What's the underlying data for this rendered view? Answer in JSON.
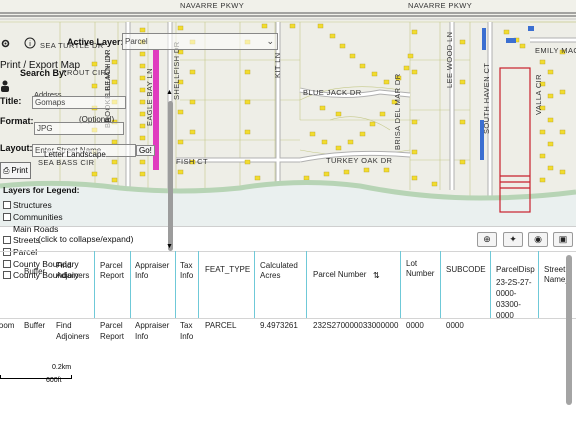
{
  "map": {
    "streets": {
      "navarre": "NAVARRE PKWY",
      "navarre2": "NAVARRE PKWY",
      "laurel_dr": "LAUREL DR",
      "emily": "EMILY MAG",
      "trout": "TROUT CIR",
      "kit_ln": "KIT LN",
      "blue_jack": "BLUE JACK DR",
      "turkey_oak": "TURKEY OAK DR",
      "fish_ct": "FISH CT",
      "bass_cir": "SEA BASS CIR",
      "brooke": "BROOKE BEACH DR",
      "eagle": "EAGLE BAY LN",
      "shelfish": "SHELLFISH DR",
      "lillian": "LILLIAN LN",
      "fernhill": "FERNHILL DR",
      "lee_wood": "LEE WOOD LN",
      "south_haven": "SOUTH HAVEN CT",
      "brisa": "BRISA DEL MAR DR",
      "vela": "VALLA CIR",
      "dolphin": "DOLPHIN DR",
      "sea_turtle": "SEA TURTLE DR"
    }
  },
  "overlay": {
    "active_layer_label": "Active Layer:",
    "active_layer_value": "Parcel",
    "print_title": "Print / Export Map",
    "search_by": "Search By:",
    "title_label": "Title:",
    "title_value": "Gomaps",
    "title_hint": "Address",
    "format_label": "Format:",
    "format_value": "JPG",
    "optional": "(Optional)",
    "layout_label": "Layout:",
    "layout_value": "Letter Landscape",
    "street_placeholder": "Enter Street Name",
    "go": "Go!",
    "print_btn": "Print",
    "legend_title": "Layers for Legend:",
    "legend_items": [
      "Structures",
      "Communities",
      "Main Roads",
      "Streets",
      "Parcel",
      "County Boundary",
      "County Boundary"
    ],
    "collapse_hint": "(click to collapse/expand)",
    "buffer": "Buffer"
  },
  "table": {
    "headers": [
      "Zoom",
      "Buffer",
      "Find\nAdjoiners",
      "Parcel\nReport",
      "Appraiser\nInfo",
      "Tax\nInfo",
      "FEAT_TYPE",
      "Calculated\nAcres",
      "Parcel Number",
      "Lot\nNumber",
      "SUBCODE",
      "ParcelDisp",
      "Street\nName"
    ],
    "row": [
      "Zoom",
      "Buffer",
      "Find\nAdjoiners",
      "Parcel\nReport",
      "Appraiser\nInfo",
      "Tax\nInfo",
      "PARCEL",
      "9.4973261",
      "232S270000033000000",
      "0000",
      "0000",
      "23-2S-27-\n0000-\n03300-\n0000",
      ""
    ]
  },
  "scale": {
    "km": "0.2km",
    "ft": "600ft"
  }
}
